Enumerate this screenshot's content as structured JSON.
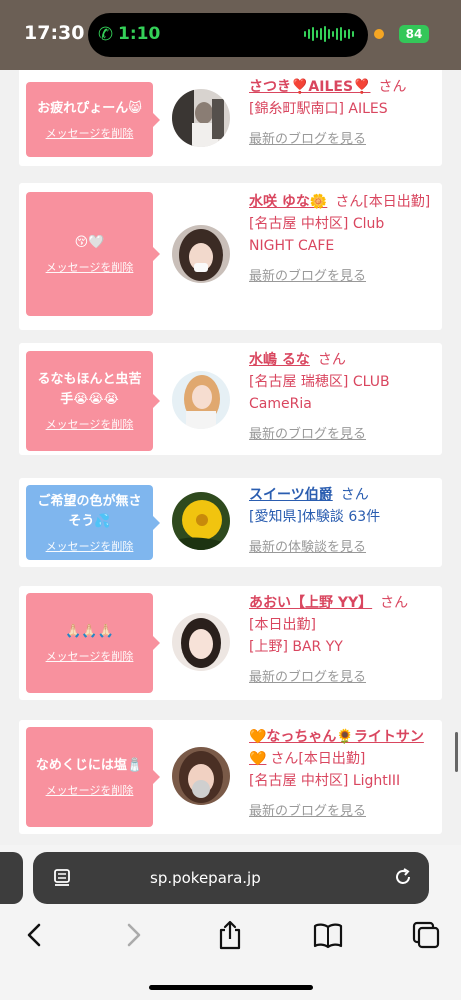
{
  "status_bar": {
    "time": "17:30",
    "call_time": "1:10",
    "battery": "84"
  },
  "cards": [
    {
      "bubble_color": "pink",
      "message": "お疲れぴょーん😸",
      "delete_label": "メッセージを削除",
      "name": "さつき❣️AILES❣️",
      "san": "さん",
      "detail_lines": [
        "[錦糸町駅南口] AILES"
      ],
      "link": "最新のブログを見る"
    },
    {
      "bubble_color": "pink",
      "message": "😚🤍",
      "delete_label": "メッセージを削除",
      "name": "水咲 ゆな🌼",
      "san": "さん[本日出勤]",
      "detail_lines": [
        "[名古屋 中村区] Club",
        "NIGHT CAFE"
      ],
      "link": "最新のブログを見る"
    },
    {
      "bubble_color": "pink",
      "message": "るなもほんと虫苦手😭😭😭",
      "delete_label": "メッセージを削除",
      "name": "水嶋 るな",
      "san": "さん",
      "detail_lines": [
        "[名古屋 瑞穂区] CLUB",
        "CameRia"
      ],
      "link": "最新のブログを見る"
    },
    {
      "bubble_color": "blue",
      "message": "ご希望の色が無さそう💦",
      "delete_label": "メッセージを削除",
      "name": "スイーツ伯爵",
      "san": "さん",
      "detail_lines": [
        "[愛知県]体験談 63件"
      ],
      "link": "最新の体験談を見る"
    },
    {
      "bubble_color": "pink",
      "message": "🙏🏻🙏🏻🙏🏻",
      "delete_label": "メッセージを削除",
      "name": "あおい【上野 YY】",
      "san": "さん",
      "detail_lines": [
        "[本日出勤]",
        "[上野] BAR YY"
      ],
      "link": "最新のブログを見る"
    },
    {
      "bubble_color": "pink",
      "message": "なめくじには塩🧂",
      "delete_label": "メッセージを削除",
      "name": "🧡なっちゃん🌻ライトサン🧡",
      "san": "さん[本日出勤]",
      "detail_lines": [
        "[名古屋 中村区] LightIII"
      ],
      "link": "最新のブログを見る"
    }
  ],
  "browser": {
    "url": "sp.pokepara.jp"
  },
  "icons": {
    "back": "back-chevron-icon",
    "forward": "forward-chevron-icon",
    "share": "share-icon",
    "bookmarks": "bookmarks-icon",
    "tabs": "tabs-icon",
    "reader": "reader-mode-icon",
    "reload": "reload-icon"
  }
}
